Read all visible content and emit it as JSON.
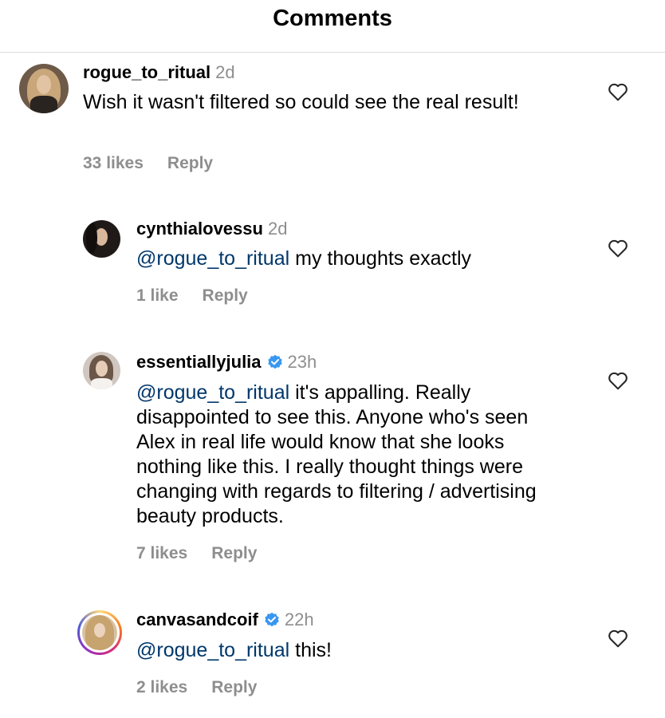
{
  "header": {
    "title": "Comments"
  },
  "comments": [
    {
      "username": "rogue_to_ritual",
      "time": "2d",
      "verified": false,
      "mention": "",
      "text": "Wish it wasn't filtered so could see the real result!",
      "likes": "33 likes",
      "reply": "Reply"
    },
    {
      "username": "cynthialovessu",
      "time": "2d",
      "verified": false,
      "mention": "@rogue_to_ritual",
      "text": " my thoughts exactly",
      "likes": "1 like",
      "reply": "Reply"
    },
    {
      "username": "essentiallyjulia",
      "time": "23h",
      "verified": true,
      "mention": "@rogue_to_ritual",
      "text": " it's appalling. Really disappointed to see this. Anyone who's seen Alex in real life would know that she looks nothing like this. I really thought things were changing with regards to filtering / advertising beauty products.",
      "likes": "7 likes",
      "reply": "Reply"
    },
    {
      "username": "canvasandcoif",
      "time": "22h",
      "verified": true,
      "mention": "@rogue_to_ritual",
      "text": " this!",
      "likes": "2 likes",
      "reply": "Reply"
    }
  ],
  "colors": {
    "mention": "#00376b",
    "secondary_text": "#8e8e8e",
    "verified": "#3897f0",
    "divider": "#dbdbdb"
  },
  "icons": {
    "like": "heart-outline-icon",
    "verified": "verified-badge-icon"
  }
}
